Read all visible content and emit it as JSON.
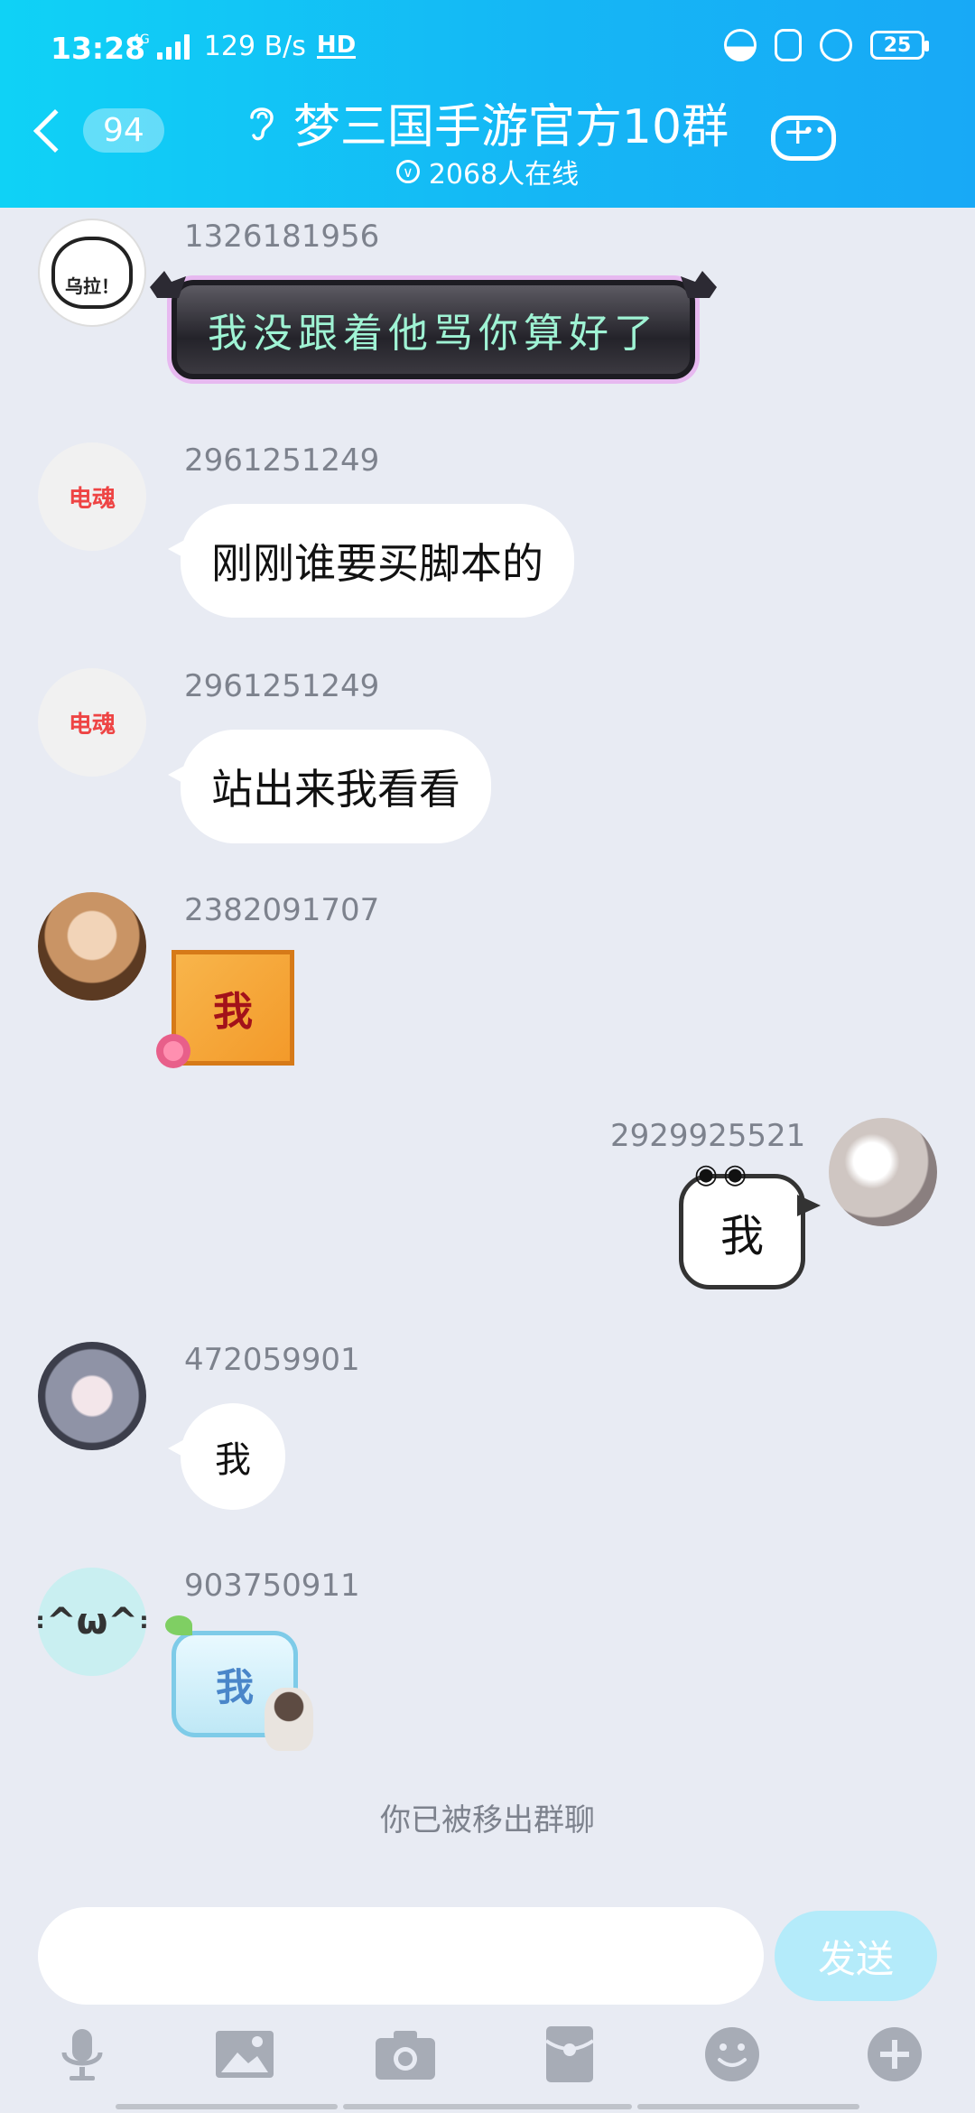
{
  "status_bar": {
    "time": "13:28",
    "network_type": "4G",
    "speed": "129 B/s",
    "hd": "HD",
    "battery": "25"
  },
  "header": {
    "unread_count": "94",
    "group_name": "梦三国手游官方10群",
    "online_count": "2068人在线"
  },
  "messages": [
    {
      "sender": "1326181956",
      "avatar": "bear",
      "avatar_text": "乌拉！",
      "type": "fancy_text",
      "text": "我没跟着他骂你算好了"
    },
    {
      "sender": "2961251249",
      "avatar": "electric-soul",
      "avatar_text": "电魂",
      "type": "text",
      "text": "刚刚谁要买脚本的"
    },
    {
      "sender": "2961251249",
      "avatar": "electric-soul",
      "avatar_text": "电魂",
      "type": "text",
      "text": "站出来我看看"
    },
    {
      "sender": "2382091707",
      "avatar": "photo",
      "type": "sticker",
      "text": "我"
    },
    {
      "sender": "2929925521",
      "avatar": "photo",
      "type": "sticker",
      "text": "我",
      "self": true
    },
    {
      "sender": "472059901",
      "avatar": "anime",
      "type": "text",
      "text": "我"
    },
    {
      "sender": "903750911",
      "avatar": "cat",
      "type": "sticker",
      "text": "我"
    }
  ],
  "system_notice": "你已被移出群聊",
  "input": {
    "placeholder": "",
    "send_label": "发送"
  },
  "toolbar_icons": [
    "microphone-icon",
    "image-icon",
    "camera-icon",
    "red-packet-icon",
    "emoji-icon",
    "plus-icon"
  ],
  "colors": {
    "header_gradient_start": "#0fd2f6",
    "header_gradient_end": "#18a9f6",
    "background": "#e8ebf3",
    "send_button": "#b4ebfa",
    "toolbar_icon": "#a7acb6"
  }
}
